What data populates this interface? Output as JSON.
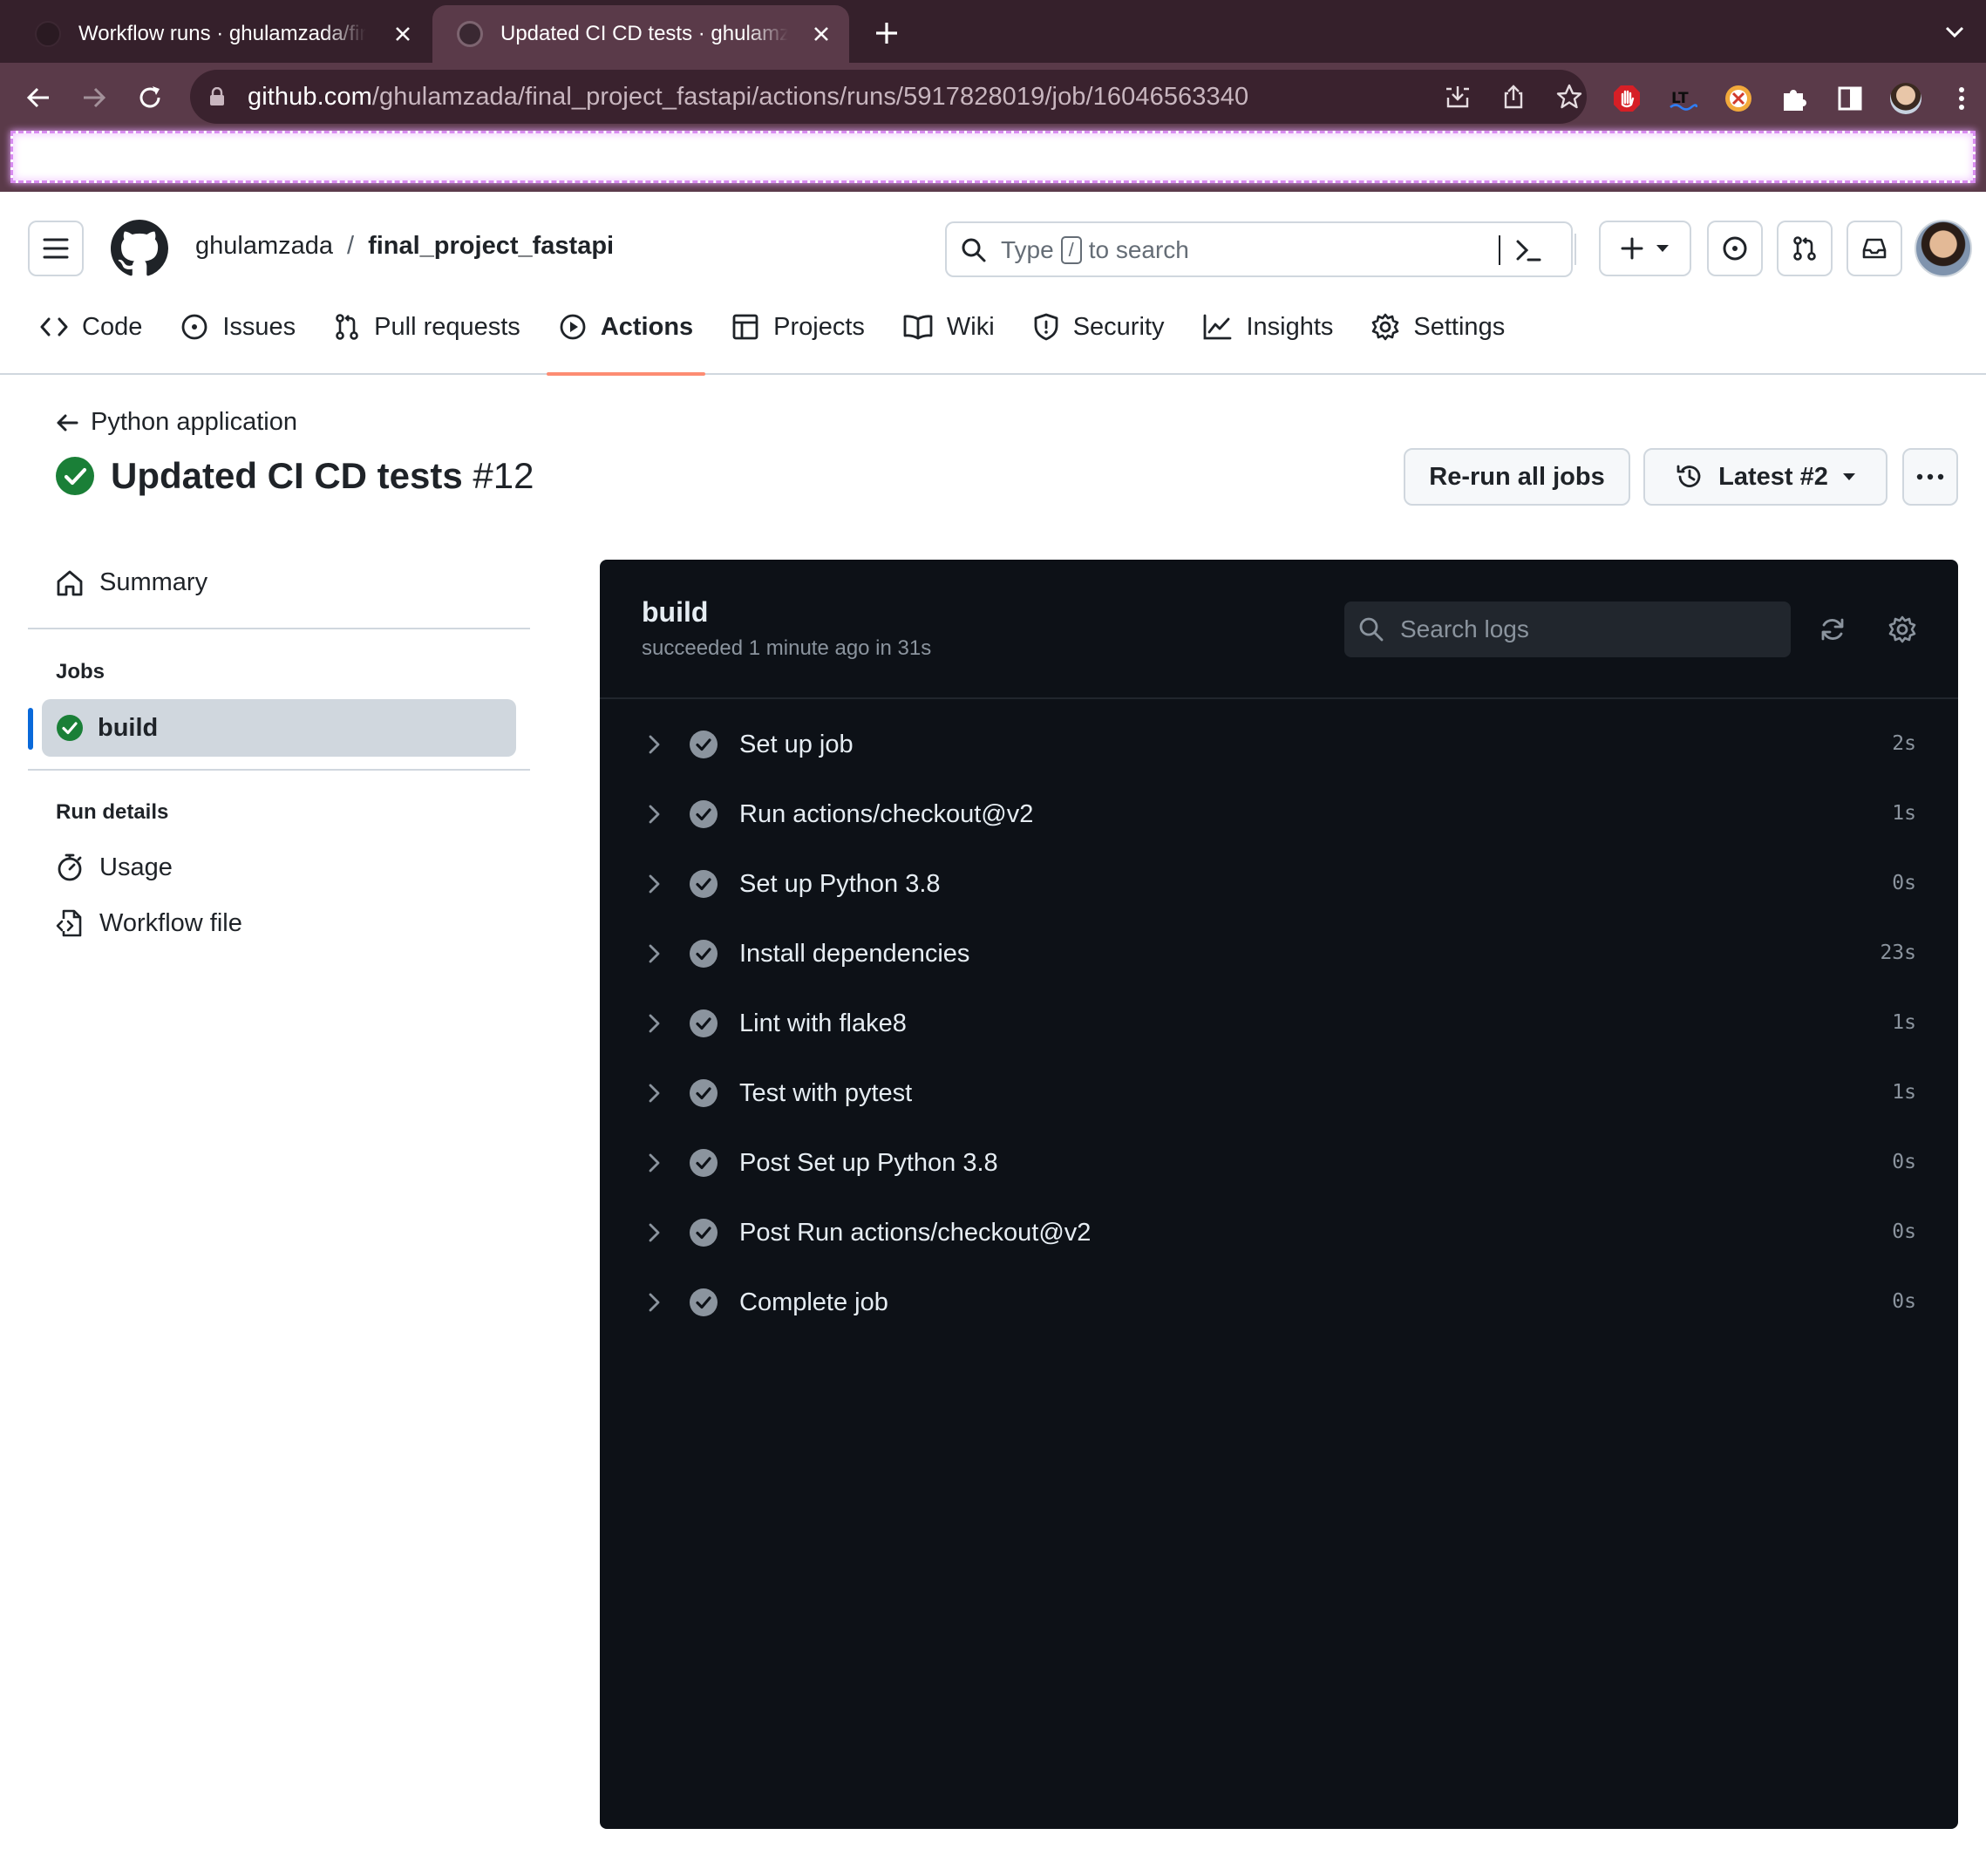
{
  "browser": {
    "tabs": [
      {
        "title": "Workflow runs · ghulamzada/final_project_fastapi",
        "active": false
      },
      {
        "title": "Updated CI CD tests · ghulamzada/final_project_fastapi",
        "active": true
      }
    ],
    "url_host": "github.com",
    "url_path": "/ghulamzada/final_project_fastapi/actions/runs/5917828019/job/16046563340",
    "extension_icons": [
      "adblock-icon",
      "translate-icon",
      "cookie-icon",
      "puzzle-icon",
      "sidepanel-icon",
      "profile-avatar-icon"
    ]
  },
  "header": {
    "owner": "ghulamzada",
    "separator": "/",
    "repo": "final_project_fastapi",
    "search_prefix": "Type",
    "search_key": "/",
    "search_suffix": "to search"
  },
  "repo_nav": [
    {
      "label": "Code",
      "icon": "code-icon"
    },
    {
      "label": "Issues",
      "icon": "issue-icon"
    },
    {
      "label": "Pull requests",
      "icon": "pull-request-icon"
    },
    {
      "label": "Actions",
      "icon": "play-icon",
      "active": true
    },
    {
      "label": "Projects",
      "icon": "table-icon"
    },
    {
      "label": "Wiki",
      "icon": "book-icon"
    },
    {
      "label": "Security",
      "icon": "shield-icon"
    },
    {
      "label": "Insights",
      "icon": "graph-icon"
    },
    {
      "label": "Settings",
      "icon": "gear-icon"
    }
  ],
  "run": {
    "back_label": "Python application",
    "title": "Updated CI CD tests",
    "number": "#12",
    "rerun_label": "Re-run all jobs",
    "attempt_label": "Latest #2"
  },
  "sidebar": {
    "summary_label": "Summary",
    "jobs_heading": "Jobs",
    "job_name": "build",
    "run_details_heading": "Run details",
    "usage_label": "Usage",
    "workflow_file_label": "Workflow file"
  },
  "log": {
    "job_title": "build",
    "status": "succeeded 1 minute ago in 31s",
    "search_placeholder": "Search logs",
    "steps": [
      {
        "name": "Set up job",
        "duration": "2s"
      },
      {
        "name": "Run actions/checkout@v2",
        "duration": "1s"
      },
      {
        "name": "Set up Python 3.8",
        "duration": "0s"
      },
      {
        "name": "Install dependencies",
        "duration": "23s"
      },
      {
        "name": "Lint with flake8",
        "duration": "1s"
      },
      {
        "name": "Test with pytest",
        "duration": "1s"
      },
      {
        "name": "Post Set up Python 3.8",
        "duration": "0s"
      },
      {
        "name": "Post Run actions/checkout@v2",
        "duration": "0s"
      },
      {
        "name": "Complete job",
        "duration": "0s"
      }
    ]
  },
  "colors": {
    "success_green": "#1a7f37",
    "active_tab_underline": "#fd8c73",
    "selected_job_bar": "#0969da",
    "log_bg": "#0d1117"
  }
}
